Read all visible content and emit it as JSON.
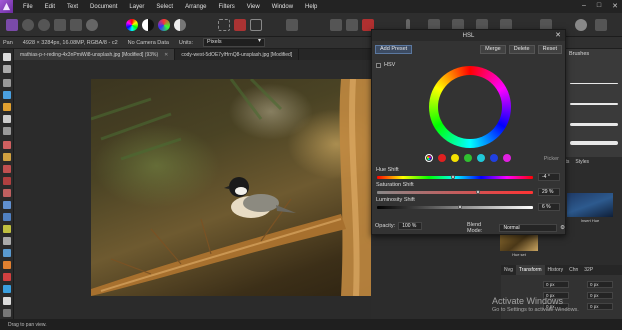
{
  "menubar": {
    "items": [
      "File",
      "Edit",
      "Text",
      "Document",
      "Layer",
      "Select",
      "Arrange",
      "Filters",
      "View",
      "Window",
      "Help"
    ],
    "controls": [
      "–",
      "□",
      "✕"
    ]
  },
  "context": {
    "tool": "Pan",
    "image_info": "4928 × 3284px, 16.08MP, RGBA/8 - c2",
    "camera": "No Camera Data",
    "units_label": "Units:",
    "units_value": "Pixels"
  },
  "doc_tabs": [
    {
      "label": "mathias-p-r-reding-4x3nPmiWi8-unsplash.jpg [Modified] (93%)",
      "close": "✕"
    },
    {
      "label": "cody-west-5dOE7ylHrnQ8-unsplash.jpg [Modified]",
      "close": "✕"
    }
  ],
  "hsl": {
    "title": "HSL",
    "close": "✕",
    "add_preset": "Add Preset",
    "merge": "Merge",
    "delete": "Delete",
    "reset": "Reset",
    "hsv_label": "HSV",
    "picker_label": "Picker",
    "swatch_colors": [
      "#e02020",
      "#f4e000",
      "#30c030",
      "#20c8d8",
      "#2040e0",
      "#e020e0"
    ],
    "hue_label": "Hue Shift",
    "hue_value": "-4 °",
    "hue_level": 0.49,
    "saturation_label": "Saturation Shift",
    "saturation_value": "29 %",
    "saturation_level": 0.645,
    "luminosity_label": "Luminosity Shift",
    "luminosity_value": "6 %",
    "luminosity_level": 0.53,
    "opacity_label": "Opacity:",
    "opacity_value": "100 %",
    "blend_label": "Blend Mode:",
    "blend_value": "Normal"
  },
  "panels": {
    "brushes_tab": "Brushes",
    "styles_tabs": [
      "cts",
      "Styles"
    ],
    "style_thumb_label": "Insert Hue",
    "thumb2_label": "Hue set",
    "tabs": [
      "Nvg",
      "Transform",
      "History",
      "Chn",
      "32P"
    ],
    "transform_fields": [
      "0 px",
      "0 px",
      "0 px",
      "0 px",
      "0 px",
      "0 px"
    ]
  },
  "watermark": {
    "title": "Activate Windows",
    "subtitle": "Go to Settings to activate Windows."
  },
  "status": {
    "text": "Drag to pan view."
  }
}
